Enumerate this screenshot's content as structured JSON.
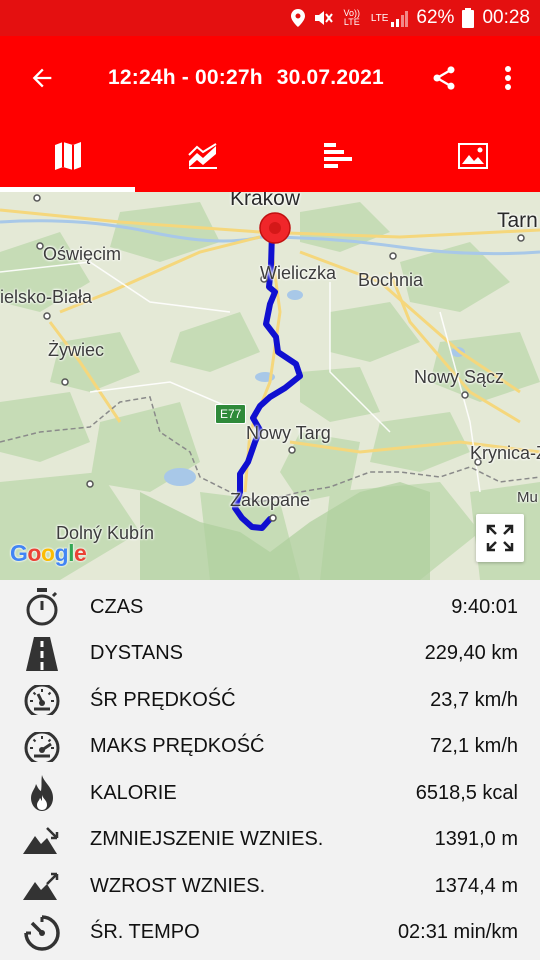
{
  "status_bar": {
    "battery": "62%",
    "time": "00:28",
    "volte": "Vo)) LTE",
    "network": "LTE"
  },
  "header": {
    "time_range": "12:24h - 00:27h",
    "date": "30.07.2021"
  },
  "tabs": [
    {
      "name": "map-icon",
      "active": true
    },
    {
      "name": "chart-icon",
      "active": false
    },
    {
      "name": "bar-list-icon",
      "active": false
    },
    {
      "name": "image-icon",
      "active": false
    }
  ],
  "map": {
    "labels": {
      "krakow": "Krakow",
      "tarnow": "Tarn",
      "oswiecim": "Oświęcim",
      "wieliczka": "Wieliczka",
      "bochnia": "Bochnia",
      "bielsko": "ielsko-Biała",
      "zywiec": "Żywiec",
      "nowy_sacz": "Nowy Sącz",
      "nowy_targ": "Nowy Targ",
      "krynica": "Krynica-Z",
      "zakopane": "Zakopane",
      "muszyna": "Mu",
      "dolny_kubin": "Dolný Kubín"
    },
    "road": "E77",
    "attribution": "Google"
  },
  "stats": [
    {
      "icon": "stopwatch-icon",
      "label": "CZAS",
      "value": "9:40:01"
    },
    {
      "icon": "road-icon",
      "label": "DYSTANS",
      "value": "229,40 km"
    },
    {
      "icon": "speedometer-icon",
      "label": "ŚR PRĘDKOŚĆ",
      "value": "23,7 km/h"
    },
    {
      "icon": "speedometer-max-icon",
      "label": "MAKS PRĘDKOŚĆ",
      "value": "72,1 km/h"
    },
    {
      "icon": "flame-icon",
      "label": "KALORIE",
      "value": "6518,5 kcal"
    },
    {
      "icon": "descent-icon",
      "label": "ZMNIEJSZENIE WZNIES.",
      "value": "1391,0 m"
    },
    {
      "icon": "ascent-icon",
      "label": "WZROST WZNIES.",
      "value": "1374,4 m"
    },
    {
      "icon": "pace-icon",
      "label": "ŚR. TEMPO",
      "value": "02:31 min/km"
    }
  ],
  "colors": {
    "primary": "#ff0000",
    "status_bar": "#e41010",
    "route": "#1010d0",
    "marker": "#f0262a"
  }
}
